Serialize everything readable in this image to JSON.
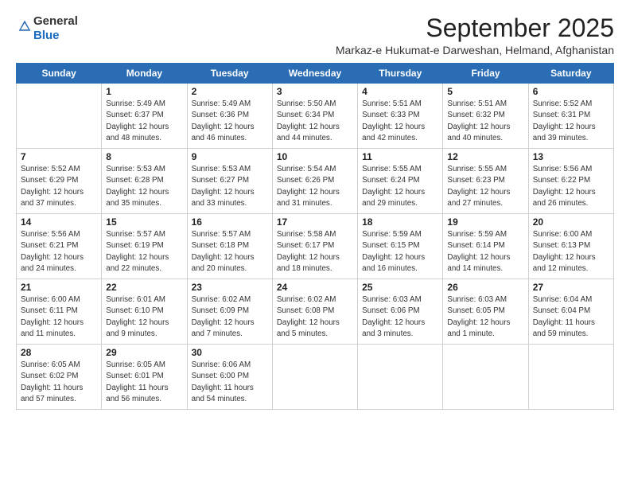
{
  "header": {
    "logo_general": "General",
    "logo_blue": "Blue",
    "month_title": "September 2025",
    "subtitle": "Markaz-e Hukumat-e Darweshan, Helmand, Afghanistan"
  },
  "days_of_week": [
    "Sunday",
    "Monday",
    "Tuesday",
    "Wednesday",
    "Thursday",
    "Friday",
    "Saturday"
  ],
  "weeks": [
    [
      {
        "day": "",
        "info": ""
      },
      {
        "day": "1",
        "info": "Sunrise: 5:49 AM\nSunset: 6:37 PM\nDaylight: 12 hours\nand 48 minutes."
      },
      {
        "day": "2",
        "info": "Sunrise: 5:49 AM\nSunset: 6:36 PM\nDaylight: 12 hours\nand 46 minutes."
      },
      {
        "day": "3",
        "info": "Sunrise: 5:50 AM\nSunset: 6:34 PM\nDaylight: 12 hours\nand 44 minutes."
      },
      {
        "day": "4",
        "info": "Sunrise: 5:51 AM\nSunset: 6:33 PM\nDaylight: 12 hours\nand 42 minutes."
      },
      {
        "day": "5",
        "info": "Sunrise: 5:51 AM\nSunset: 6:32 PM\nDaylight: 12 hours\nand 40 minutes."
      },
      {
        "day": "6",
        "info": "Sunrise: 5:52 AM\nSunset: 6:31 PM\nDaylight: 12 hours\nand 39 minutes."
      }
    ],
    [
      {
        "day": "7",
        "info": "Sunrise: 5:52 AM\nSunset: 6:29 PM\nDaylight: 12 hours\nand 37 minutes."
      },
      {
        "day": "8",
        "info": "Sunrise: 5:53 AM\nSunset: 6:28 PM\nDaylight: 12 hours\nand 35 minutes."
      },
      {
        "day": "9",
        "info": "Sunrise: 5:53 AM\nSunset: 6:27 PM\nDaylight: 12 hours\nand 33 minutes."
      },
      {
        "day": "10",
        "info": "Sunrise: 5:54 AM\nSunset: 6:26 PM\nDaylight: 12 hours\nand 31 minutes."
      },
      {
        "day": "11",
        "info": "Sunrise: 5:55 AM\nSunset: 6:24 PM\nDaylight: 12 hours\nand 29 minutes."
      },
      {
        "day": "12",
        "info": "Sunrise: 5:55 AM\nSunset: 6:23 PM\nDaylight: 12 hours\nand 27 minutes."
      },
      {
        "day": "13",
        "info": "Sunrise: 5:56 AM\nSunset: 6:22 PM\nDaylight: 12 hours\nand 26 minutes."
      }
    ],
    [
      {
        "day": "14",
        "info": "Sunrise: 5:56 AM\nSunset: 6:21 PM\nDaylight: 12 hours\nand 24 minutes."
      },
      {
        "day": "15",
        "info": "Sunrise: 5:57 AM\nSunset: 6:19 PM\nDaylight: 12 hours\nand 22 minutes."
      },
      {
        "day": "16",
        "info": "Sunrise: 5:57 AM\nSunset: 6:18 PM\nDaylight: 12 hours\nand 20 minutes."
      },
      {
        "day": "17",
        "info": "Sunrise: 5:58 AM\nSunset: 6:17 PM\nDaylight: 12 hours\nand 18 minutes."
      },
      {
        "day": "18",
        "info": "Sunrise: 5:59 AM\nSunset: 6:15 PM\nDaylight: 12 hours\nand 16 minutes."
      },
      {
        "day": "19",
        "info": "Sunrise: 5:59 AM\nSunset: 6:14 PM\nDaylight: 12 hours\nand 14 minutes."
      },
      {
        "day": "20",
        "info": "Sunrise: 6:00 AM\nSunset: 6:13 PM\nDaylight: 12 hours\nand 12 minutes."
      }
    ],
    [
      {
        "day": "21",
        "info": "Sunrise: 6:00 AM\nSunset: 6:11 PM\nDaylight: 12 hours\nand 11 minutes."
      },
      {
        "day": "22",
        "info": "Sunrise: 6:01 AM\nSunset: 6:10 PM\nDaylight: 12 hours\nand 9 minutes."
      },
      {
        "day": "23",
        "info": "Sunrise: 6:02 AM\nSunset: 6:09 PM\nDaylight: 12 hours\nand 7 minutes."
      },
      {
        "day": "24",
        "info": "Sunrise: 6:02 AM\nSunset: 6:08 PM\nDaylight: 12 hours\nand 5 minutes."
      },
      {
        "day": "25",
        "info": "Sunrise: 6:03 AM\nSunset: 6:06 PM\nDaylight: 12 hours\nand 3 minutes."
      },
      {
        "day": "26",
        "info": "Sunrise: 6:03 AM\nSunset: 6:05 PM\nDaylight: 12 hours\nand 1 minute."
      },
      {
        "day": "27",
        "info": "Sunrise: 6:04 AM\nSunset: 6:04 PM\nDaylight: 11 hours\nand 59 minutes."
      }
    ],
    [
      {
        "day": "28",
        "info": "Sunrise: 6:05 AM\nSunset: 6:02 PM\nDaylight: 11 hours\nand 57 minutes."
      },
      {
        "day": "29",
        "info": "Sunrise: 6:05 AM\nSunset: 6:01 PM\nDaylight: 11 hours\nand 56 minutes."
      },
      {
        "day": "30",
        "info": "Sunrise: 6:06 AM\nSunset: 6:00 PM\nDaylight: 11 hours\nand 54 minutes."
      },
      {
        "day": "",
        "info": ""
      },
      {
        "day": "",
        "info": ""
      },
      {
        "day": "",
        "info": ""
      },
      {
        "day": "",
        "info": ""
      }
    ]
  ]
}
